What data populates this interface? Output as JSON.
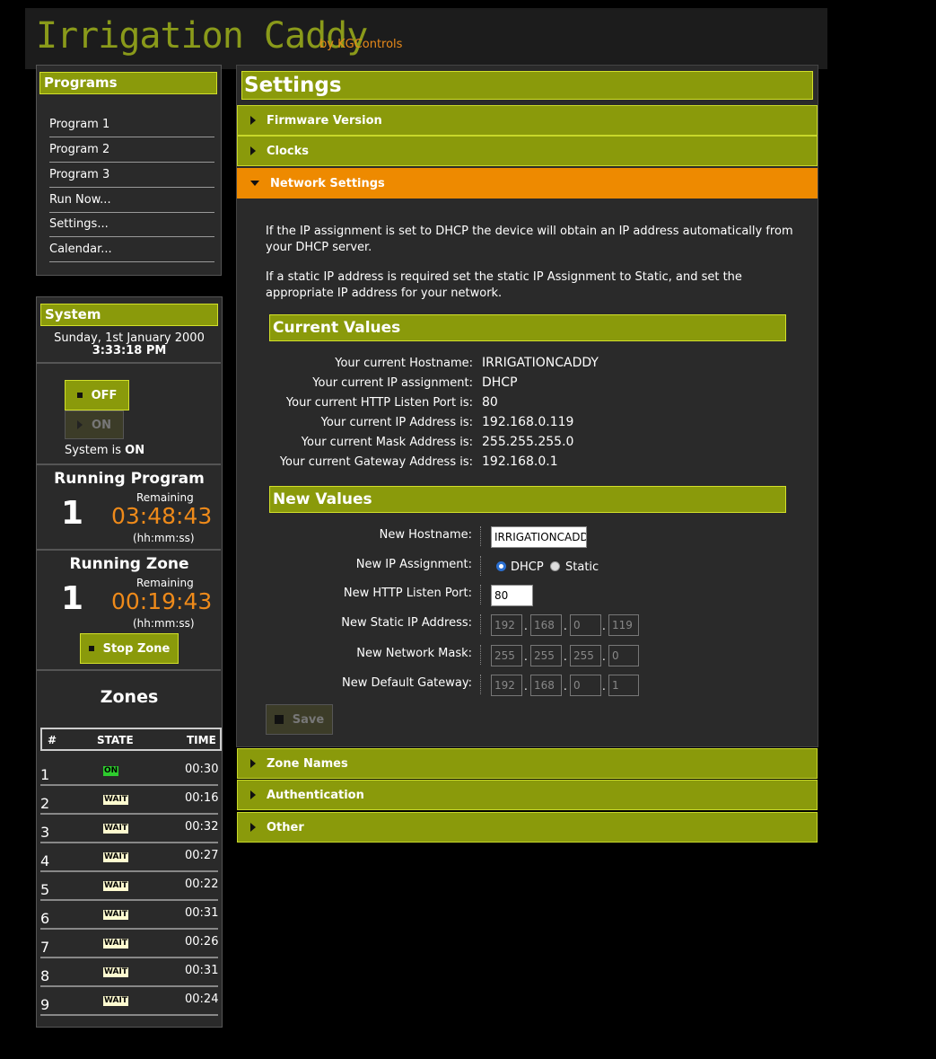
{
  "header": {
    "brand": "Irrigation Caddy",
    "by": "by KGControls"
  },
  "programs": {
    "title": "Programs",
    "items": [
      "Program 1",
      "Program 2",
      "Program 3",
      "Run Now...",
      "Settings...",
      "Calendar..."
    ]
  },
  "system": {
    "title": "System",
    "date": "Sunday, 1st January 2000",
    "time": "3:33:18 PM",
    "off_label": "OFF",
    "on_label": "ON",
    "status_prefix": "System is",
    "status_value": "ON"
  },
  "running_program": {
    "title": "Running Program",
    "number": "1",
    "remaining_label": "Remaining",
    "remaining": "03:48:43",
    "unit": "(hh:mm:ss)"
  },
  "running_zone": {
    "title": "Running Zone",
    "number": "1",
    "remaining_label": "Remaining",
    "remaining": "00:19:43",
    "unit": "(hh:mm:ss)",
    "stop_label": "Stop Zone"
  },
  "zones": {
    "title": "Zones",
    "columns": [
      "#",
      "STATE",
      "TIME"
    ],
    "rows": [
      {
        "num": "1",
        "state": "ON",
        "time": "00:30"
      },
      {
        "num": "2",
        "state": "WAIT",
        "time": "00:16"
      },
      {
        "num": "3",
        "state": "WAIT",
        "time": "00:32"
      },
      {
        "num": "4",
        "state": "WAIT",
        "time": "00:27"
      },
      {
        "num": "5",
        "state": "WAIT",
        "time": "00:22"
      },
      {
        "num": "6",
        "state": "WAIT",
        "time": "00:31"
      },
      {
        "num": "7",
        "state": "WAIT",
        "time": "00:26"
      },
      {
        "num": "8",
        "state": "WAIT",
        "time": "00:31"
      },
      {
        "num": "9",
        "state": "WAIT",
        "time": "00:24"
      }
    ]
  },
  "settings": {
    "title": "Settings",
    "sections_top": [
      "Firmware Version",
      "Clocks"
    ],
    "active_section": "Network Settings",
    "sections_bottom": [
      "Zone Names",
      "Authentication",
      "Other"
    ],
    "para1": "If the IP assignment is set to DHCP the device will obtain an IP address automatically from your DHCP server.",
    "para2": "If a static IP address is required set the static IP Assignment to Static, and set the appropriate IP address for your network.",
    "current_title": "Current Values",
    "current": [
      {
        "label": "Your current Hostname:",
        "value": "IRRIGATIONCADDY"
      },
      {
        "label": "Your current IP assignment:",
        "value": "DHCP"
      },
      {
        "label": "Your current HTTP Listen Port is:",
        "value": "80"
      },
      {
        "label": "Your current IP Address is:",
        "value": "192.168.0.119"
      },
      {
        "label": "Your current Mask Address is:",
        "value": "255.255.255.0"
      },
      {
        "label": "Your current Gateway Address is:",
        "value": "192.168.0.1"
      }
    ],
    "new_title": "New Values",
    "new_hostname_label": "New Hostname:",
    "new_hostname_value": "IRRIGATIONCADDY",
    "new_ip_assignment_label": "New IP Assignment:",
    "dhcp_label": "DHCP",
    "static_label": "Static",
    "new_port_label": "New HTTP Listen Port:",
    "new_port_value": "80",
    "new_static_ip_label": "New Static IP Address:",
    "static_ip": [
      "192",
      "168",
      "0",
      "119"
    ],
    "new_mask_label": "New Network Mask:",
    "mask": [
      "255",
      "255",
      "255",
      "0"
    ],
    "new_gateway_label": "New Default Gateway:",
    "gateway": [
      "192",
      "168",
      "0",
      "1"
    ],
    "save_label": "Save"
  },
  "colors": {
    "olive": "#8a9a0b",
    "orange": "#ee8a00",
    "panel": "#2a2a2a"
  }
}
